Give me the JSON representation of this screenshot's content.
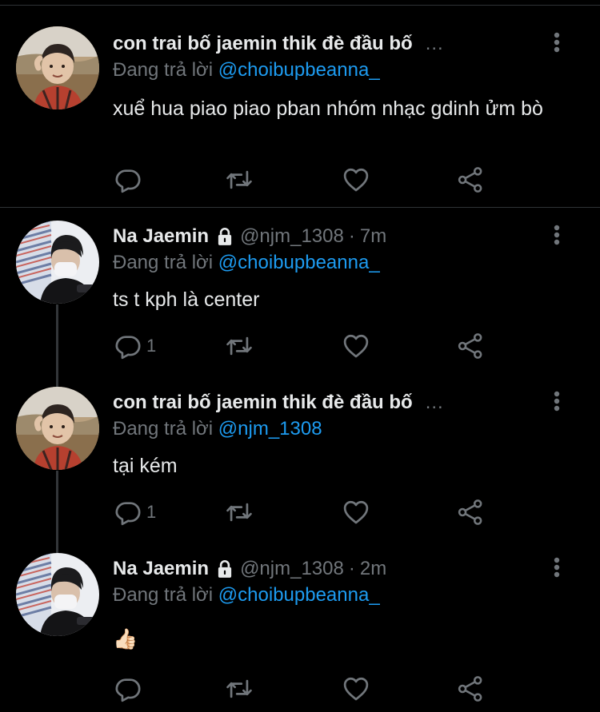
{
  "reply_prefix": "Đang trả lời",
  "colors": {
    "background": "#000000",
    "text": "#e7e9ea",
    "muted": "#71767b",
    "link": "#1d9bf0",
    "divider": "#2f3336"
  },
  "tweets": [
    {
      "name": "con trai bố jaemin thik đè đầu bố",
      "handle": "",
      "time": "",
      "truncated_marker": "...",
      "locked": false,
      "reply_to": "@choibupbeanna_",
      "text": "xuể hua piao piao pban nhóm nhạc gdinh ửm bò",
      "reply_count": "",
      "avatar": "avatar-child-photo"
    },
    {
      "name": "Na Jaemin",
      "handle": "@njm_1308",
      "separator": "·",
      "time": "7m",
      "locked": true,
      "reply_to": "@choibupbeanna_",
      "text": "ts t kph là center",
      "reply_count": "1",
      "avatar": "avatar-masked-person-photo"
    },
    {
      "name": "con trai bố jaemin thik đè đầu bố",
      "handle": "",
      "time": "",
      "truncated_marker": "...",
      "locked": false,
      "reply_to": "@njm_1308",
      "text": "tại kém",
      "reply_count": "1",
      "avatar": "avatar-child-photo"
    },
    {
      "name": "Na Jaemin",
      "handle": "@njm_1308",
      "separator": "·",
      "time": "2m",
      "locked": true,
      "reply_to": "@choibupbeanna_",
      "text": "👍🏻",
      "reply_count": "",
      "avatar": "avatar-masked-person-photo"
    }
  ],
  "icons": {
    "reply": "reply-bubble-icon",
    "retweet": "retweet-arrows-icon",
    "like": "heart-icon",
    "share": "share-nodes-icon",
    "more": "vertical-dots-icon",
    "lock": "lock-icon"
  }
}
